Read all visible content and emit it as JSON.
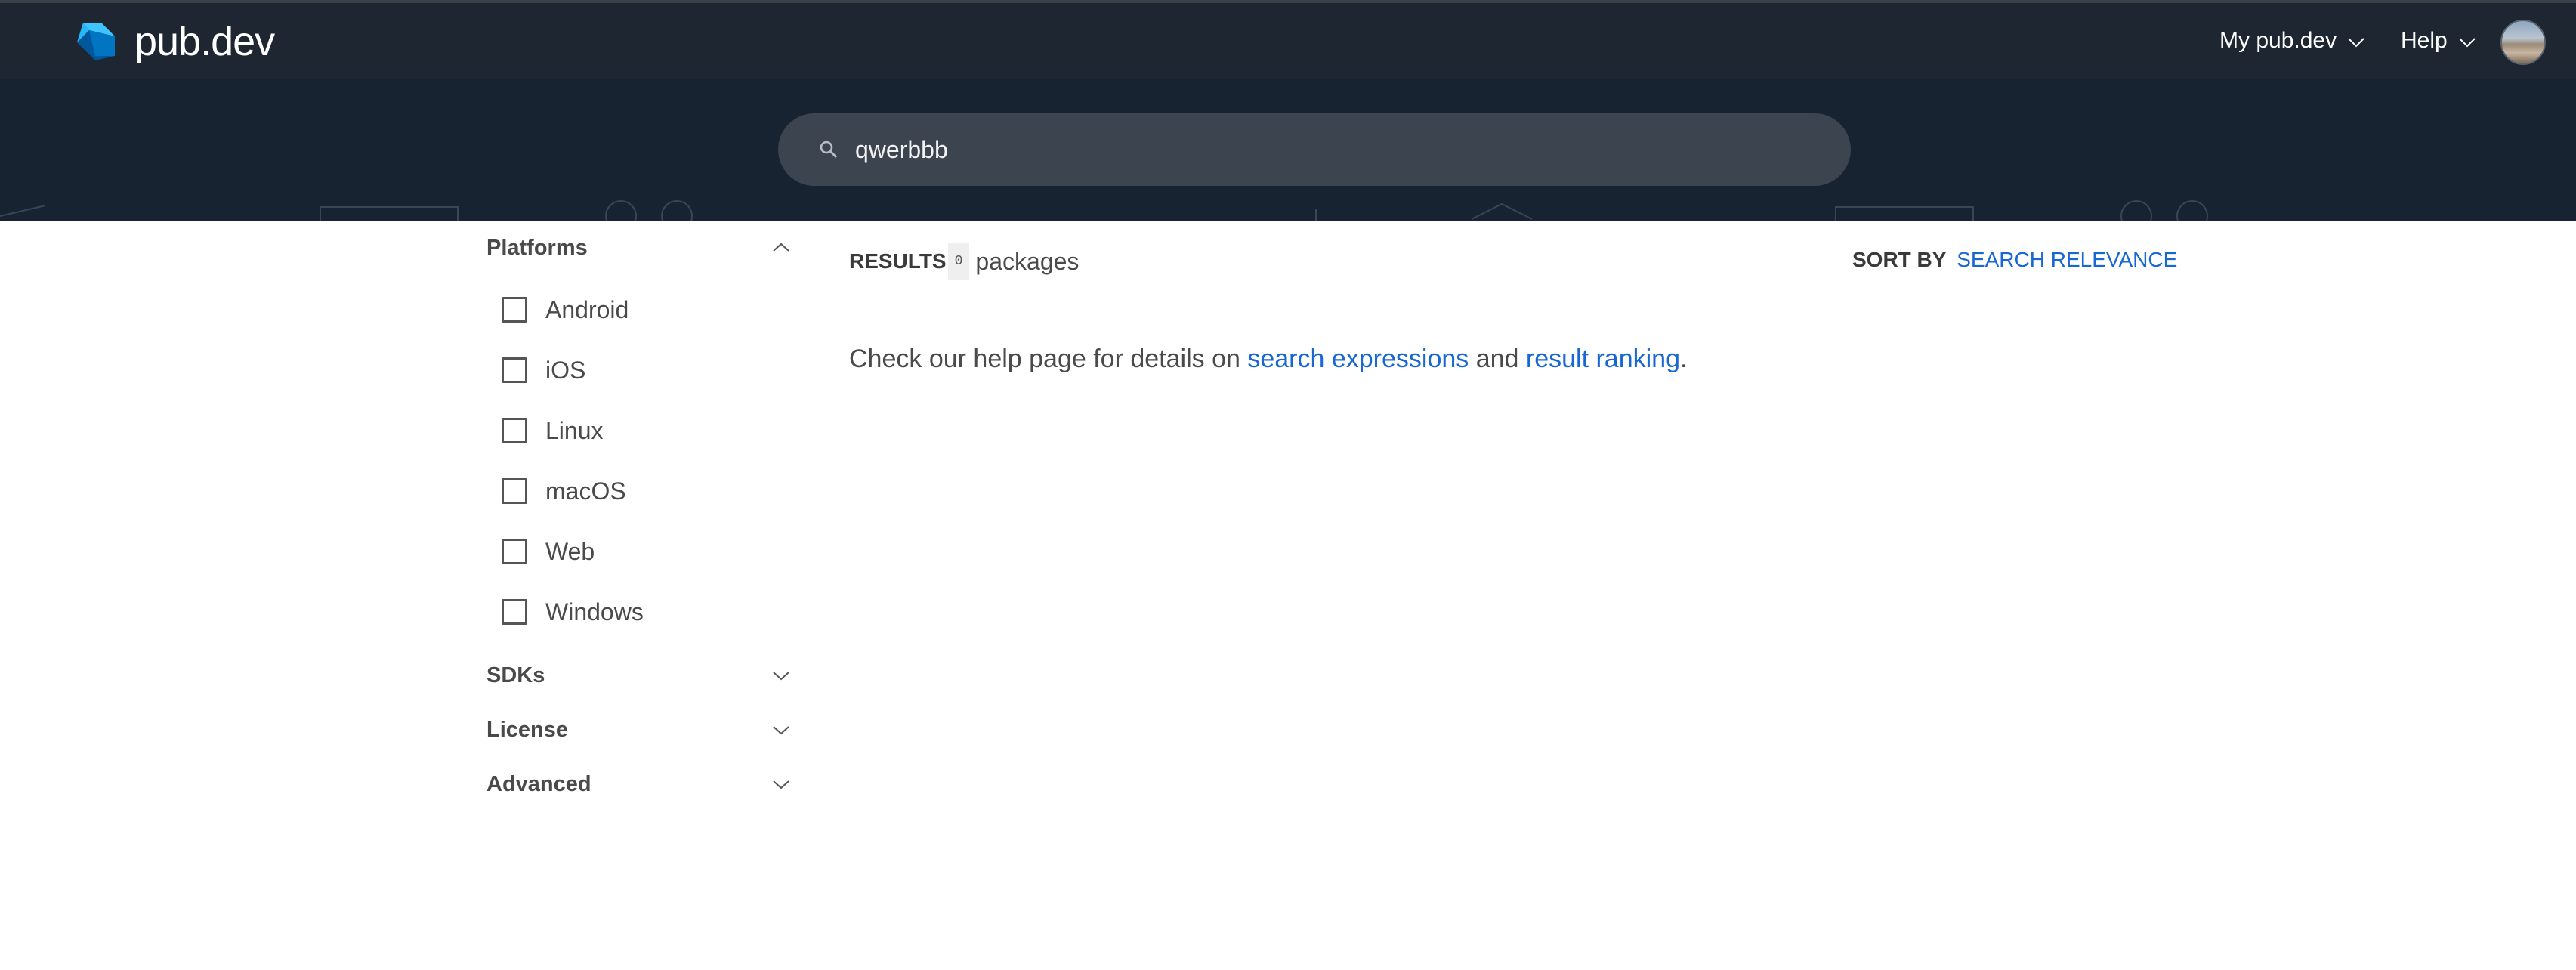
{
  "header": {
    "site_name": "pub.dev",
    "nav": [
      {
        "label": "My pub.dev"
      },
      {
        "label": "Help"
      }
    ],
    "avatar_icon": "user-avatar"
  },
  "search": {
    "value": "qwerbbb",
    "icon": "search-icon"
  },
  "sidebar": {
    "platforms": {
      "title": "Platforms",
      "expanded": true,
      "options": [
        "Android",
        "iOS",
        "Linux",
        "macOS",
        "Web",
        "Windows"
      ]
    },
    "sdks": {
      "title": "SDKs",
      "expanded": false
    },
    "license": {
      "title": "License",
      "expanded": false
    },
    "advanced": {
      "title": "Advanced",
      "expanded": false
    }
  },
  "results": {
    "label": "RESULTS",
    "count": "0",
    "unit": "packages"
  },
  "sort": {
    "label": "SORT BY",
    "value": "SEARCH RELEVANCE"
  },
  "help": {
    "prefix": "Check our help page for details on ",
    "link1": "search expressions",
    "middle": " and ",
    "link2": "result ranking",
    "suffix": "."
  },
  "colors": {
    "header_bg": "#1e2731",
    "banner_bg": "#182331",
    "search_bg": "#3c4450",
    "link": "#1967d2"
  }
}
